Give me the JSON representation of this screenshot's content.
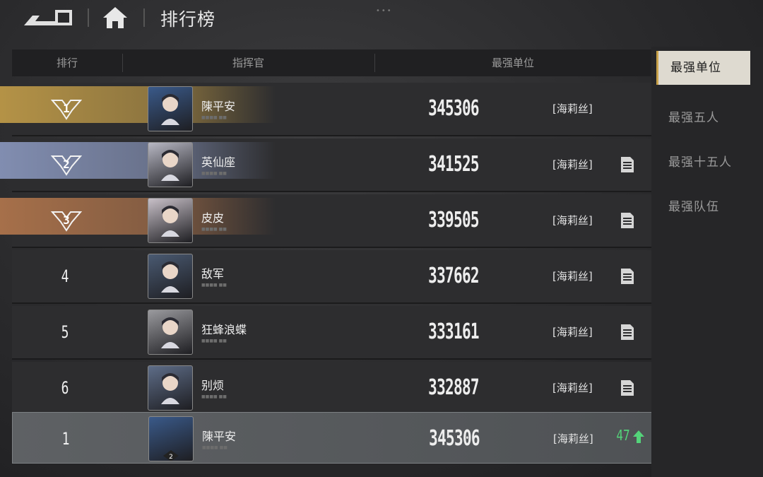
{
  "header": {
    "title": "排行榜"
  },
  "table": {
    "columns": [
      "排行",
      "指挥官",
      "最强单位"
    ]
  },
  "rows": [
    {
      "rank": "1",
      "name": "陳平安",
      "sub": "■■■■ ■■",
      "score": "345306",
      "unit": "[海莉丝]",
      "medal": "gold",
      "avatar_color": "#3a5a8a"
    },
    {
      "rank": "2",
      "name": "英仙座",
      "sub": "■■■■ ■■",
      "score": "341525",
      "unit": "[海莉丝]",
      "medal": "silver",
      "avatar_color": "#b8b8c4"
    },
    {
      "rank": "3",
      "name": "皮皮",
      "sub": "■■■■ ■■",
      "score": "339505",
      "unit": "[海莉丝]",
      "medal": "bronze",
      "avatar_color": "#c8c0c8"
    },
    {
      "rank": "4",
      "name": "敌军",
      "sub": "■■■■ ■■",
      "score": "337662",
      "unit": "[海莉丝]",
      "avatar_color": "#4a5a72"
    },
    {
      "rank": "5",
      "name": "狂蜂浪蝶",
      "sub": "■■■■ ■■",
      "score": "333161",
      "unit": "[海莉丝]",
      "avatar_color": "#9a9a9e"
    },
    {
      "rank": "6",
      "name": "别烦",
      "sub": "■■■■ ■■",
      "score": "332887",
      "unit": "[海莉丝]",
      "avatar_color": "#5e6d88"
    }
  ],
  "me": {
    "rank": "1",
    "name": "陳平安",
    "sub": "■■■■ ■■",
    "score": "345306",
    "unit": "[海莉丝]",
    "change": "47",
    "avatar_color": "#3a5a8a"
  },
  "tabs": [
    {
      "label": "最强单位",
      "active": true
    },
    {
      "label": "最强五人"
    },
    {
      "label": "最强十五人"
    },
    {
      "label": "最强队伍"
    }
  ],
  "colors": {
    "gold": "#c9a24a",
    "silver": "#8e9cc4",
    "bronze": "#b97a4e",
    "up": "#54d37a"
  }
}
